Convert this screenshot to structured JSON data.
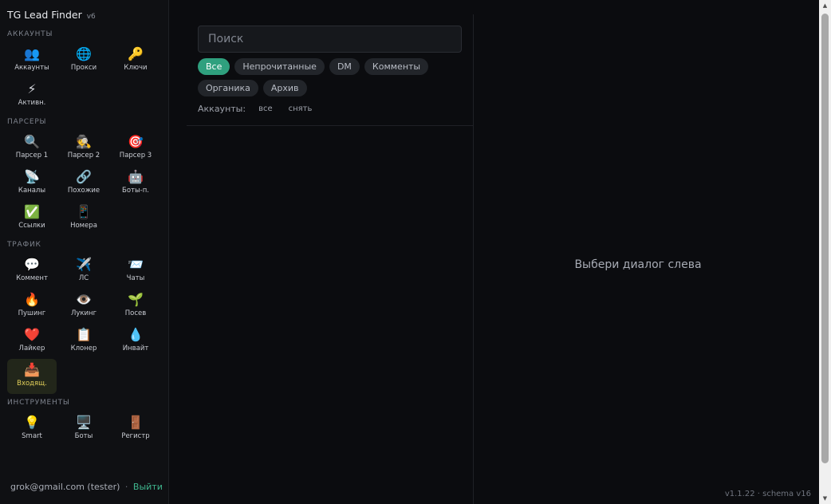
{
  "app": {
    "title": "TG Lead Finder",
    "version_badge": "v6"
  },
  "sidebar": {
    "sections": [
      {
        "title": "АККАУНТЫ",
        "items": [
          {
            "label": "Аккаунты",
            "icon": "👥",
            "icon_name": "accounts-icon"
          },
          {
            "label": "Прокси",
            "icon": "🌐",
            "icon_name": "globe-icon"
          },
          {
            "label": "Ключи",
            "icon": "🔑",
            "icon_name": "key-icon"
          },
          {
            "label": "Активн.",
            "icon": "⚡",
            "icon_name": "lightning-icon"
          }
        ]
      },
      {
        "title": "ПАРСЕРЫ",
        "items": [
          {
            "label": "Парсер 1",
            "icon": "🔍",
            "icon_name": "magnifier-icon"
          },
          {
            "label": "Парсер 2",
            "icon": "🕵️",
            "icon_name": "detective-icon"
          },
          {
            "label": "Парсер 3",
            "icon": "🎯",
            "icon_name": "target-icon"
          },
          {
            "label": "Каналы",
            "icon": "📡",
            "icon_name": "satellite-icon"
          },
          {
            "label": "Похожие",
            "icon": "🔗",
            "icon_name": "link-icon"
          },
          {
            "label": "Боты-п.",
            "icon": "🤖",
            "icon_name": "robot-icon"
          },
          {
            "label": "Ссылки",
            "icon": "✅",
            "icon_name": "checkmark-icon"
          },
          {
            "label": "Номера",
            "icon": "📱",
            "icon_name": "phone-icon"
          }
        ]
      },
      {
        "title": "ТРАФИК",
        "items": [
          {
            "label": "Коммент",
            "icon": "💬",
            "icon_name": "speech-bubble-icon"
          },
          {
            "label": "ЛС",
            "icon": "✈️",
            "icon_name": "airplane-icon"
          },
          {
            "label": "Чаты",
            "icon": "📨",
            "icon_name": "envelope-icon"
          },
          {
            "label": "Пушинг",
            "icon": "🔥",
            "icon_name": "fire-icon"
          },
          {
            "label": "Лукинг",
            "icon": "👁️",
            "icon_name": "eye-icon"
          },
          {
            "label": "Посев",
            "icon": "🌱",
            "icon_name": "seedling-icon"
          },
          {
            "label": "Лайкер",
            "icon": "❤️",
            "icon_name": "heart-icon"
          },
          {
            "label": "Клонер",
            "icon": "📋",
            "icon_name": "clipboard-icon"
          },
          {
            "label": "Инвайт",
            "icon": "💧",
            "icon_name": "droplet-icon"
          },
          {
            "label": "Входящ.",
            "icon": "📥",
            "icon_name": "inbox-icon",
            "active": true
          }
        ]
      },
      {
        "title": "ИНСТРУМЕНТЫ",
        "items": [
          {
            "label": "Smart",
            "icon": "💡",
            "icon_name": "lightbulb-icon"
          },
          {
            "label": "Боты",
            "icon": "🖥️",
            "icon_name": "monitor-icon"
          },
          {
            "label": "Регистр",
            "icon": "🚪",
            "icon_name": "door-icon"
          }
        ]
      }
    ],
    "footer": {
      "user": "grok@gmail.com (tester)",
      "separator": "·",
      "logout": "Выйти"
    }
  },
  "list": {
    "search_placeholder": "Поиск",
    "filters": [
      {
        "label": "Все",
        "active": true
      },
      {
        "label": "Непрочитанные"
      },
      {
        "label": "DM"
      },
      {
        "label": "Комменты"
      },
      {
        "label": "Органика"
      },
      {
        "label": "Архив"
      }
    ],
    "accounts_label": "Аккаунты:",
    "accounts_all": "все",
    "accounts_clear": "снять"
  },
  "detail": {
    "empty_message": "Выбери диалог слева"
  },
  "version_text": "v1.1.22 · schema v16",
  "colors": {
    "accent": "#2fa07e",
    "active_tile_bg": "#22261a",
    "active_tile_text": "#e4d25a",
    "logout": "#3fb68e"
  }
}
